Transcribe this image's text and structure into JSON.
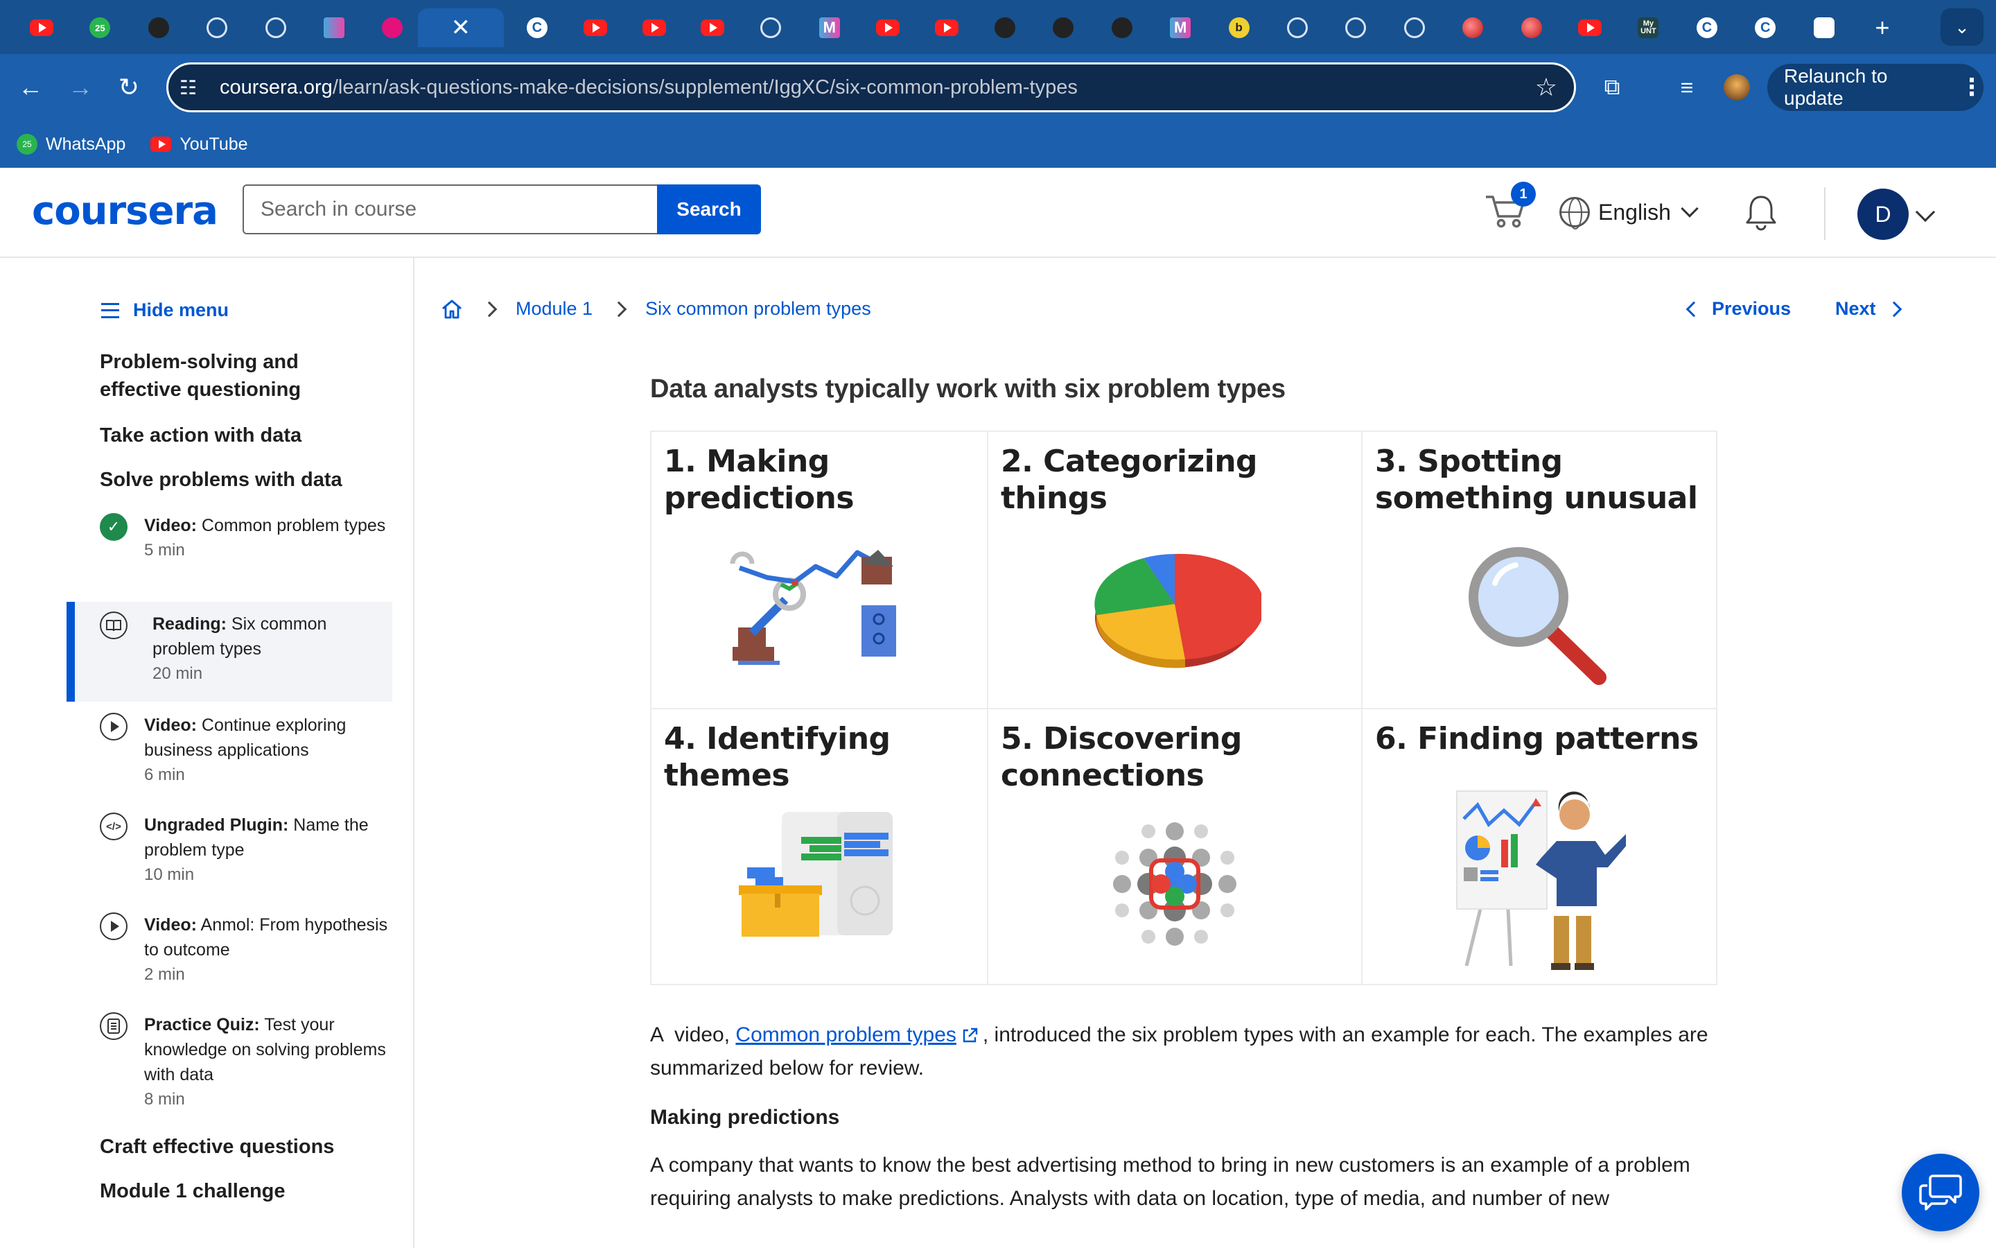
{
  "browser": {
    "tabs": [
      {
        "icon": "youtube-icon"
      },
      {
        "icon": "whatsapp-icon",
        "badge": "25"
      },
      {
        "icon": "perplexity-icon"
      },
      {
        "icon": "circle-icon"
      },
      {
        "icon": "github-icon"
      },
      {
        "icon": "play-store-icon"
      },
      {
        "icon": "pink-app-icon"
      },
      {
        "icon": "close-icon",
        "active": true
      },
      {
        "icon": "coursera-icon"
      },
      {
        "icon": "youtube-icon"
      },
      {
        "icon": "youtube-icon"
      },
      {
        "icon": "youtube-icon"
      },
      {
        "icon": "compass-icon"
      },
      {
        "icon": "m-app-icon"
      },
      {
        "icon": "youtube-icon"
      },
      {
        "icon": "youtube-icon"
      },
      {
        "icon": "gt-icon"
      },
      {
        "icon": "perplexity-icon"
      },
      {
        "icon": "camera-icon"
      },
      {
        "icon": "m-app-icon"
      },
      {
        "icon": "b-app-icon"
      },
      {
        "icon": "target-icon"
      },
      {
        "icon": "target-icon"
      },
      {
        "icon": "circle-icon"
      },
      {
        "icon": "red-ball-icon"
      },
      {
        "icon": "red-ball-icon"
      },
      {
        "icon": "youtube-icon"
      },
      {
        "icon": "myunt-icon",
        "text": "My UNT"
      },
      {
        "icon": "coursera-icon"
      },
      {
        "icon": "coursera-icon"
      },
      {
        "icon": "chatgpt-icon"
      },
      {
        "icon": "plus-icon"
      }
    ],
    "url_host": "coursera.org",
    "url_path": "/learn/ask-questions-make-decisions/supplement/IggXC/six-common-problem-types",
    "relaunch_label": "Relaunch to update",
    "bookmarks": [
      {
        "label": "WhatsApp",
        "icon": "whatsapp-icon",
        "badge": "25"
      },
      {
        "label": "YouTube",
        "icon": "youtube-icon"
      }
    ]
  },
  "header": {
    "logo": "coursera",
    "search_placeholder": "Search in course",
    "search_label": "Search",
    "cart_count": "1",
    "language": "English",
    "avatar_initial": "D"
  },
  "sidebar": {
    "hide_menu": "Hide menu",
    "sections": [
      "Problem-solving and effective questioning",
      "Take action with data",
      "Solve problems with data"
    ],
    "items": [
      {
        "type": "Video:",
        "title": " Common problem types",
        "duration": "5 min",
        "icon": "check-circle-icon",
        "status": "completed"
      },
      {
        "type": "Reading:",
        "title": " Six common problem types",
        "duration": "20 min",
        "icon": "book-icon",
        "status": "current"
      },
      {
        "type": "Video:",
        "title": " Continue exploring business applications",
        "duration": "6 min",
        "icon": "play-circle-icon"
      },
      {
        "type": "Ungraded Plugin:",
        "title": " Name the problem type",
        "duration": "10 min",
        "icon": "code-icon"
      },
      {
        "type": "Video:",
        "title": " Anmol: From hypothesis to outcome",
        "duration": "2 min",
        "icon": "play-circle-icon"
      },
      {
        "type": "Practice Quiz:",
        "title": " Test your knowledge on solving problems with data",
        "duration": "8 min",
        "icon": "quiz-icon"
      }
    ],
    "sections_after": [
      "Craft effective questions",
      "Module 1 challenge"
    ]
  },
  "breadcrumb": {
    "module": "Module 1",
    "page": "Six common problem types"
  },
  "pager": {
    "previous": "Previous",
    "next": "Next"
  },
  "article": {
    "heading": "Data analysts typically work with six problem types",
    "problem_types": [
      {
        "title": "1. Making predictions",
        "icon": "robot-arm-chart-icon"
      },
      {
        "title": "2. Categorizing things",
        "icon": "pie-chart-icon"
      },
      {
        "title": "3. Spotting something unusual",
        "icon": "magnifying-glass-icon"
      },
      {
        "title": "4. Identifying themes",
        "icon": "boxes-sorting-icon"
      },
      {
        "title": "5. Discovering connections",
        "icon": "dots-network-icon"
      },
      {
        "title": "6. Finding patterns",
        "icon": "person-chart-board-icon"
      }
    ],
    "intro_before": "A  video, ",
    "intro_link": "Common problem types",
    "intro_after": ", introduced the six problem types with an example for each. The examples are summarized below for review.",
    "subheading": "Making predictions",
    "para_text": "A company that wants to know the best advertising method to bring in new customers is an example of a problem requiring analysts to make predictions. Analysts with data on location, type of media, and number of new"
  },
  "colors": {
    "browser_blue": "#1b5fad",
    "coursera_blue": "#0056d2",
    "completed_green": "#1e8a4c"
  }
}
